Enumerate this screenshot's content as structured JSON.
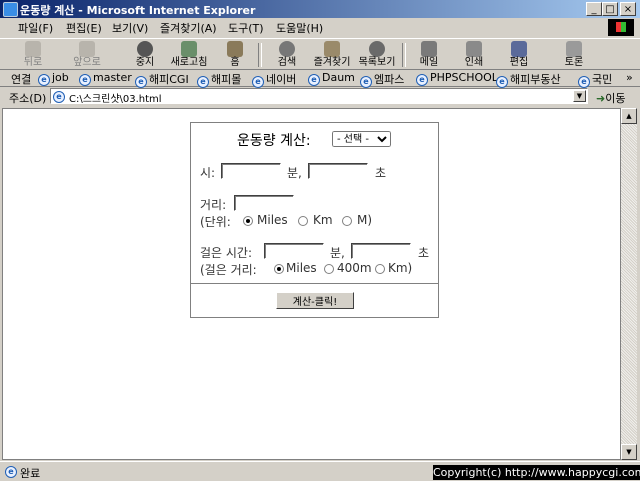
{
  "window": {
    "title": "운동량 계산 - Microsoft Internet Explorer",
    "buttons": {
      "minimize": "_",
      "maximize": "□",
      "close": "×"
    }
  },
  "menu": [
    "파일(F)",
    "편집(E)",
    "보기(V)",
    "즐겨찾기(A)",
    "도구(T)",
    "도움말(H)"
  ],
  "toolbar": {
    "back": "뒤로",
    "forward": "앞으로",
    "stop": "중지",
    "refresh": "새로고침",
    "home": "홈",
    "search": "검색",
    "favorites": "즐겨찾기",
    "history": "목록보기",
    "mail": "메일",
    "print": "인쇄",
    "edit": "편집",
    "discuss": "토론"
  },
  "links": {
    "label": "연결",
    "items": [
      "job",
      "master",
      "해피CGI",
      "해피몰",
      "네이버",
      "Daum",
      "엠파스",
      "PHPSCHOOL",
      "해피부동산",
      "국민"
    ],
    "more": "»"
  },
  "address": {
    "label": "주소(D)",
    "value": "C:\\스크린샷\\03.html",
    "go": "이동"
  },
  "form": {
    "title": "운동량 계산:",
    "select_value": "- 선택 -",
    "time_label": "시:",
    "min_label": "분,",
    "sec_label": "초",
    "distance_label": "거리:",
    "unit_label": "(단위:",
    "unit_options": [
      "Miles",
      "Km",
      "M)"
    ],
    "walk_time_label": "걸은 시간:",
    "walk_min_label": "분,",
    "walk_sec_label": "초",
    "walk_dist_label": "(걸은 거리:",
    "walk_options": [
      "Miles",
      "400m",
      "Km)"
    ],
    "button": "계산-클릭!"
  },
  "status": {
    "text": "완료"
  },
  "copyright": "Copyright(c) http://www.happycgi.com",
  "colors": {
    "titlebar_start": "#0a246a",
    "titlebar_end": "#a6caf0",
    "chrome": "#d4d0c8"
  }
}
